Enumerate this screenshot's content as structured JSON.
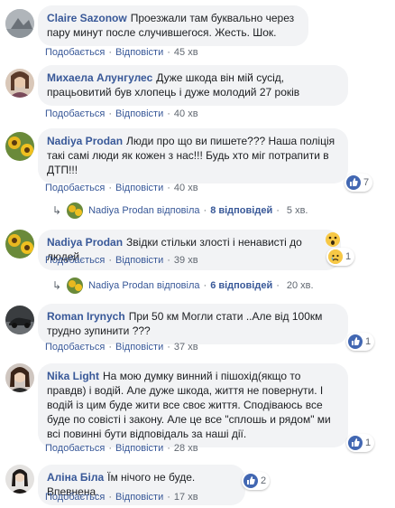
{
  "colors": {
    "link": "#385898",
    "bubble": "#f2f3f5",
    "meta": "#606770",
    "like": "#4267b2"
  },
  "actions": {
    "like": "Подобається",
    "reply": "Відповісти",
    "sep": "·"
  },
  "comments": [
    {
      "author": "Claire Sazonow",
      "text": "Проезжали там буквально через пару минут после случившегося. Жесть. Шок.",
      "time": "45 хв"
    },
    {
      "author": "Михаела Алунгулес",
      "text": "Дуже шкода він мій сусід, працьовитий був хлопець і дуже молодий 27 років",
      "time": "40 хв"
    },
    {
      "author": "Nadiya Prodan",
      "text": "Люди про що ви пишете??? Наша поліція такі самі люди як кожен з нас!!! Будь хто міг потрапити в ДТП!!!",
      "time": "40 хв",
      "reaction_count": "7",
      "replies": {
        "name": "Nadiya Prodan",
        "verb": "відповіла",
        "count_label": "8 відповідей",
        "time": "5 хв."
      }
    },
    {
      "author": "Nadiya Prodan",
      "text": "Звідки стільки злості і ненависті до людей",
      "time": "39 хв",
      "reaction_count": "1",
      "replies": {
        "name": "Nadiya Prodan",
        "verb": "відповіла",
        "count_label": "6 відповідей",
        "time": "20 хв."
      }
    },
    {
      "author": "Roman Irynych",
      "text": "При 50 км Могли стати ..Але від 100км трудно зупинити ???",
      "time": "37 хв",
      "reaction_count": "1"
    },
    {
      "author": "Nika Light",
      "text": "На мою думку винний і пішохід(якщо то правдв) і водій. Але дуже шкода, життя не повернути. І водій із цим буде жити все своє життя. Сподіваюсь все буде по совісті і закону. Але це все \"сплошь и рядом\" ми всі повинні бути відповідаль за наші дії.",
      "time": "28 хв",
      "reaction_count": "1"
    },
    {
      "author": "Аліна Біла",
      "text": "Їм нічого не буде. Впевнена.",
      "time": "17 хв",
      "reaction_count": "2"
    }
  ]
}
